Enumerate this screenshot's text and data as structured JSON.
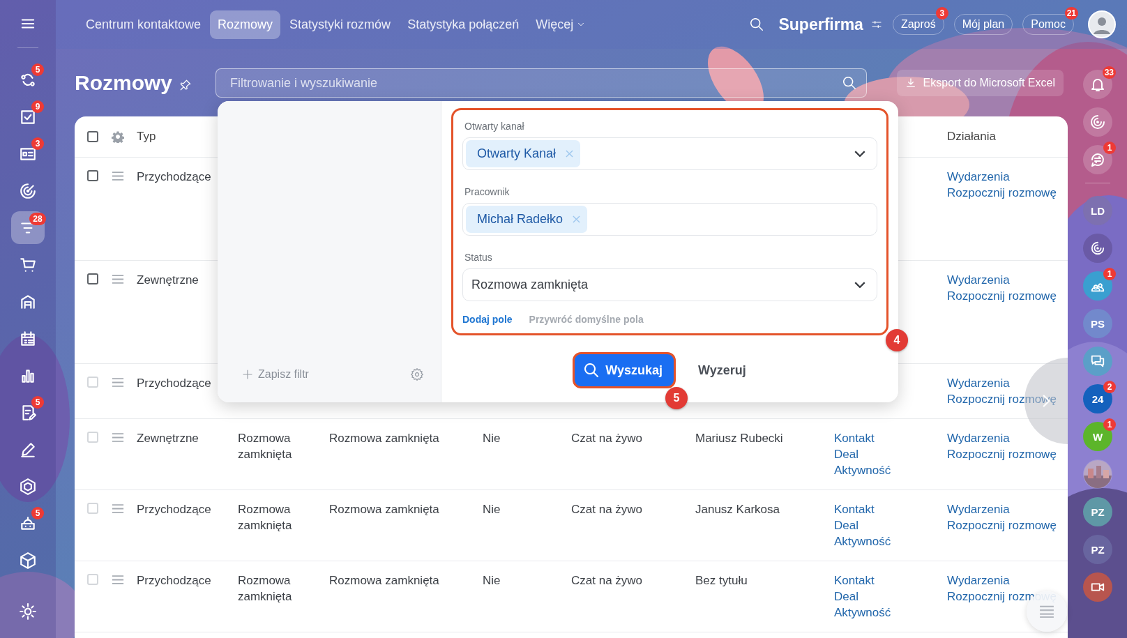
{
  "topbar": {
    "tabs": [
      {
        "label": "Centrum kontaktowe",
        "selected": false
      },
      {
        "label": "Rozmowy",
        "selected": true
      },
      {
        "label": "Statystyki rozmów",
        "selected": false
      },
      {
        "label": "Statystyka połączeń",
        "selected": false
      }
    ],
    "more": "Więcej",
    "company": "Superfirma",
    "buttons": [
      {
        "label": "Zaproś",
        "badge": "3"
      },
      {
        "label": "Mój plan"
      },
      {
        "label": "Pomoc",
        "badge": "21"
      }
    ]
  },
  "sidebar": {
    "items": [
      {
        "badge": "5",
        "selected": false
      },
      {
        "badge": "9",
        "selected": false
      },
      {
        "badge": "3",
        "selected": false
      },
      {
        "selected": false
      },
      {
        "badge": "28",
        "selected": true
      },
      {
        "selected": false
      },
      {
        "selected": false
      },
      {
        "selected": false
      },
      {
        "selected": false
      },
      {
        "badge": "5",
        "selected": false
      },
      {
        "selected": false
      },
      {
        "selected": false
      },
      {
        "badge": "5",
        "selected": false
      },
      {
        "selected": false
      },
      {
        "selected": false
      }
    ]
  },
  "page": {
    "title": "Rozmowy",
    "filter": {
      "placeholder": "Filtrowanie i wyszukiwanie"
    },
    "export_button": "Eksport do Microsoft Excel"
  },
  "table": {
    "select_all_checked": false,
    "columns": [
      {
        "label": "Typ"
      },
      {
        "label": "Działania"
      }
    ],
    "rows": [
      {
        "type": "Przychodzące",
        "checked": false,
        "disabled": false,
        "actions": [
          "Wydarzenia",
          "Rozpocznij rozmowę"
        ]
      },
      {
        "type": "Zewnętrzne",
        "checked": false,
        "disabled": false,
        "actions": [
          "Wydarzenia",
          "Rozpocznij rozmowę"
        ]
      },
      {
        "type": "Przychodzące",
        "checked": false,
        "disabled": true,
        "actions": [
          "Wydarzenia",
          "Rozpocznij rozmowę"
        ]
      },
      {
        "type": "Zewnętrzne",
        "checked": false,
        "disabled": true,
        "cells": [
          "Rozmowa zamknięta",
          "Rozmowa zamknięta",
          "Nie",
          "Czat na żywo",
          "Mariusz Rubecki"
        ],
        "links": [
          "Kontakt",
          "Deal",
          "Aktywność"
        ],
        "actions": [
          "Wydarzenia",
          "Rozpocznij rozmowę"
        ]
      },
      {
        "type": "Przychodzące",
        "checked": false,
        "disabled": true,
        "cells": [
          "Rozmowa zamknięta",
          "Rozmowa zamknięta",
          "Nie",
          "Czat na żywo",
          "Janusz Karkosa"
        ],
        "links": [
          "Kontakt",
          "Deal",
          "Aktywność"
        ],
        "actions": [
          "Wydarzenia",
          "Rozpocznij rozmowę"
        ]
      },
      {
        "type": "Przychodzące",
        "checked": false,
        "disabled": true,
        "cells": [
          "Rozmowa zamknięta",
          "Rozmowa zamknięta",
          "Nie",
          "Czat na żywo",
          "Bez tytułu"
        ],
        "links": [
          "Kontakt",
          "Deal",
          "Aktywność"
        ],
        "actions": [
          "Wydarzenia",
          "Rozpocznij rozmowę"
        ]
      }
    ]
  },
  "filter_popup": {
    "save_filter": "Zapisz filtr",
    "fields": [
      {
        "label": "Otwarty kanał",
        "kind": "multi",
        "tags": [
          "Otwarty Kanał"
        ],
        "dropdown": true
      },
      {
        "label": "Pracownik",
        "kind": "multi",
        "tags": [
          "Michał Radełko"
        ],
        "dropdown": false
      },
      {
        "label": "Status",
        "kind": "select",
        "value": "Rozmowa zamknięta",
        "dropdown": true
      }
    ],
    "add_field": "Dodaj pole",
    "restore_fields": "Przywróć domyślne pola",
    "search_button": "Wyszukaj",
    "reset_button": "Wyzeruj",
    "callouts": [
      "4",
      "5"
    ]
  },
  "right_bar_top": [
    {
      "kind": "bell",
      "badge": "33"
    },
    {
      "kind": "spiral"
    },
    {
      "kind": "chat-swap",
      "badge": "1"
    }
  ],
  "right_bar": [
    {
      "kind": "initials",
      "label": "LD",
      "color": "#7d70b0"
    },
    {
      "kind": "spiral",
      "color": "#6a5aa6"
    },
    {
      "kind": "users",
      "badge": "1",
      "color": "#3a9fd0"
    },
    {
      "kind": "initials",
      "label": "PS",
      "color": "#7289cc"
    },
    {
      "kind": "chat-bubbles",
      "color": "#5b9fc8"
    },
    {
      "kind": "initials",
      "label": "24",
      "badge": "2",
      "color": "#1461bd"
    },
    {
      "kind": "initials",
      "label": "W",
      "badge": "1",
      "color": "#5cb52a"
    },
    {
      "kind": "picture"
    },
    {
      "kind": "initials",
      "label": "PZ",
      "color": "#5f98a6"
    },
    {
      "kind": "initials",
      "label": "PZ",
      "color": "#68659f"
    },
    {
      "kind": "video",
      "color": "#b8554e"
    }
  ]
}
